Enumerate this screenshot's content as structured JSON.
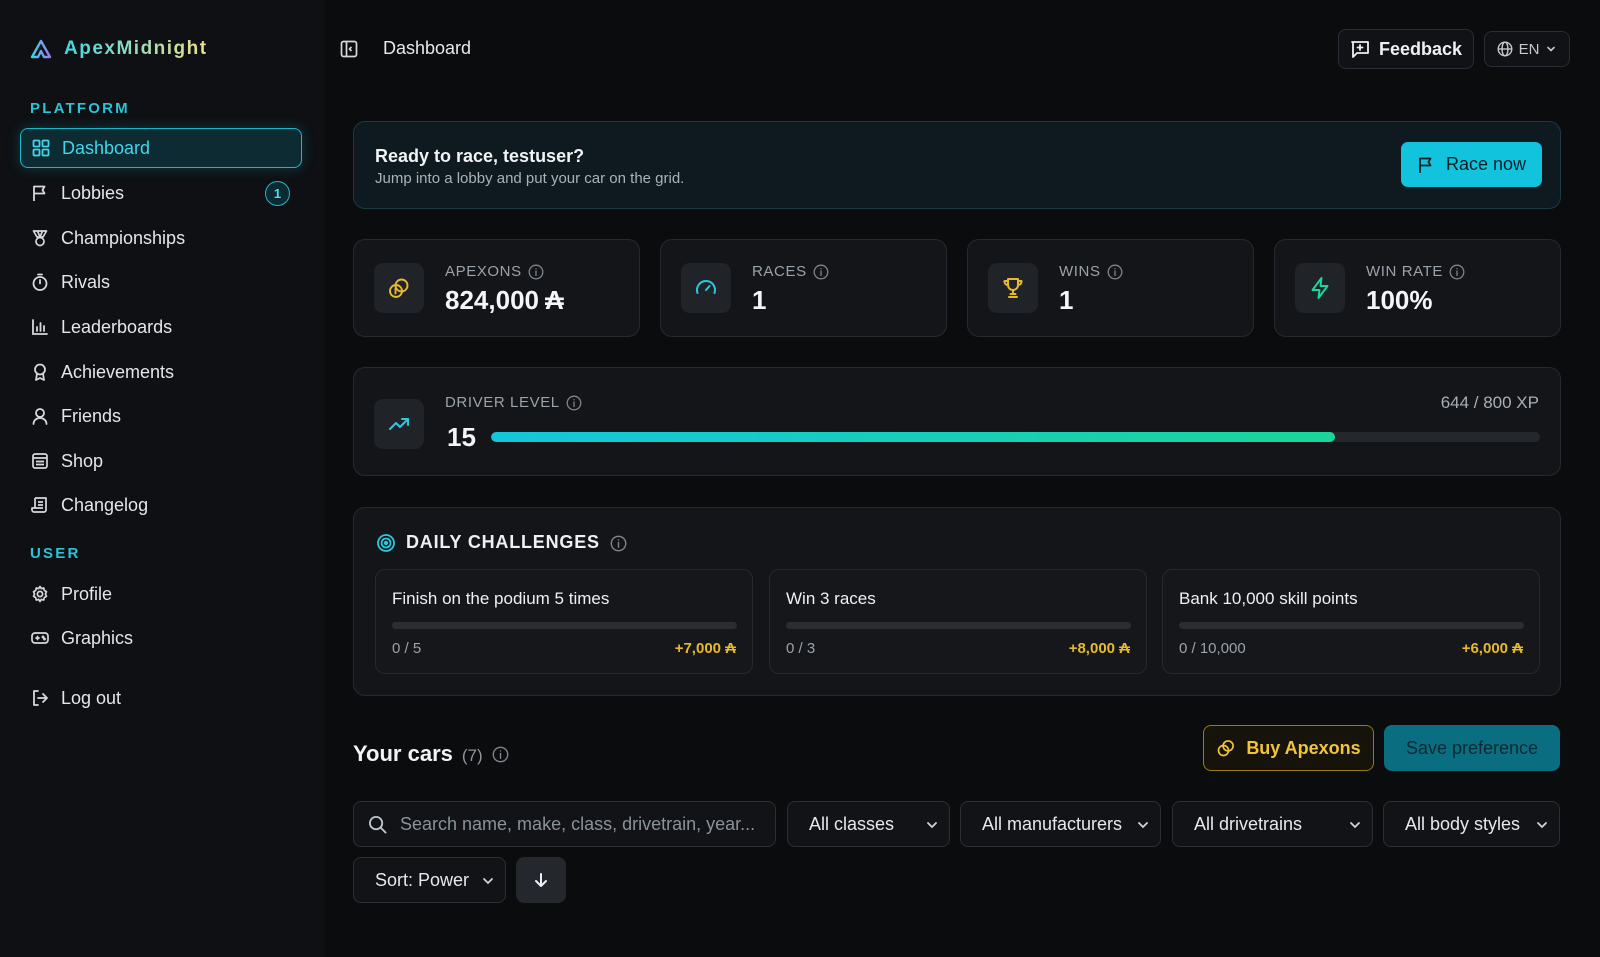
{
  "brand": {
    "name": "ApexMidnight"
  },
  "sidebar": {
    "platform_label": "PLATFORM",
    "platform_items": [
      {
        "label": "Dashboard"
      },
      {
        "label": "Lobbies",
        "badge": "1"
      },
      {
        "label": "Championships"
      },
      {
        "label": "Rivals"
      },
      {
        "label": "Leaderboards"
      },
      {
        "label": "Achievements"
      },
      {
        "label": "Friends"
      },
      {
        "label": "Shop"
      },
      {
        "label": "Changelog"
      }
    ],
    "user_label": "USER",
    "user_items": [
      {
        "label": "Profile"
      },
      {
        "label": "Graphics"
      }
    ],
    "logout_label": "Log out"
  },
  "header": {
    "title": "Dashboard",
    "feedback_label": "Feedback",
    "language": "EN"
  },
  "hero": {
    "title": "Ready to race, testuser?",
    "subtitle": "Jump into a lobby and put your car on the grid.",
    "cta_label": "Race now"
  },
  "stats": [
    {
      "label": "APEXONS",
      "value": "824,000",
      "currency_symbol": "₳"
    },
    {
      "label": "RACES",
      "value": "1"
    },
    {
      "label": "WINS",
      "value": "1"
    },
    {
      "label": "WIN RATE",
      "value": "100%"
    }
  ],
  "level": {
    "label": "DRIVER LEVEL",
    "value": "15",
    "xp_text": "644 / 800 XP",
    "progress_fraction": 0.805
  },
  "challenges": {
    "title": "DAILY CHALLENGES",
    "items": [
      {
        "title": "Finish on the podium 5 times",
        "progress": "0 / 5",
        "reward": "+7,000 ₳",
        "progress_fraction": 0
      },
      {
        "title": "Win 3 races",
        "progress": "0 / 3",
        "reward": "+8,000 ₳",
        "progress_fraction": 0
      },
      {
        "title": "Bank 10,000 skill points",
        "progress": "0 / 10,000",
        "reward": "+6,000 ₳",
        "progress_fraction": 0
      }
    ]
  },
  "cars": {
    "title": "Your cars",
    "count": "(7)",
    "buy_label": "Buy Apexons",
    "save_label": "Save preference",
    "search_placeholder": "Search name, make, class, drivetrain, year...",
    "filters": {
      "class": "All classes",
      "manufacturer": "All manufacturers",
      "drivetrain": "All drivetrains",
      "body_style": "All body styles",
      "sort": "Sort: Power"
    }
  },
  "colors": {
    "accent": "#11c3dd",
    "gold": "#e8b92c",
    "xp_gradient_end": "#1ad59a"
  }
}
